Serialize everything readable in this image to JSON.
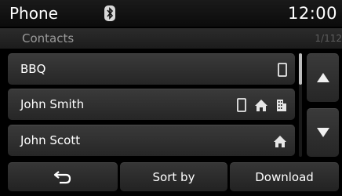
{
  "statusbar": {
    "title": "Phone",
    "time": "12:00",
    "icon": "bluetooth-icon"
  },
  "subheader": {
    "title": "Contacts",
    "page_count": "1/112"
  },
  "contacts": [
    {
      "name": "BBQ",
      "icons": [
        "mobile-phone-icon"
      ]
    },
    {
      "name": "John Smith",
      "icons": [
        "mobile-phone-icon",
        "home-icon",
        "office-icon"
      ]
    },
    {
      "name": "John Scott",
      "icons": [
        "home-icon"
      ]
    }
  ],
  "side_controls": {
    "up_icon": "arrow-up-icon",
    "down_icon": "arrow-down-icon"
  },
  "bottom_bar": {
    "back_icon": "back-arrow-icon",
    "sort_label": "Sort by",
    "download_label": "Download"
  },
  "colors": {
    "background": "#000000",
    "button": "#2e2e2e",
    "text": "#ffffff",
    "muted_text": "#9a9a9a"
  }
}
